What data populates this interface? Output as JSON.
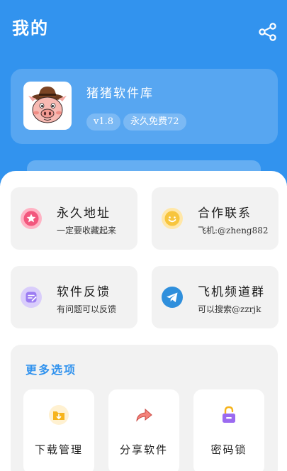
{
  "header": {
    "title": "我的",
    "share_icon": "share-icon",
    "background_color": "#3293ee"
  },
  "profile": {
    "app_name": "猪猪软件库",
    "version": "v1.8",
    "free_badge": "永久免费72",
    "avatar_icon": "pig-cowboy-avatar"
  },
  "tiles": [
    {
      "title": "永久地址",
      "subtitle": "一定要收藏起来",
      "icon": "star-icon"
    },
    {
      "title": "合作联系",
      "subtitle": "飞机:@zheng882",
      "icon": "smile-chat-icon"
    },
    {
      "title": "软件反馈",
      "subtitle": "有问题可以反馈",
      "icon": "feedback-icon"
    },
    {
      "title": "飞机频道群",
      "subtitle": "可以搜索@zzrjk",
      "icon": "telegram-icon"
    }
  ],
  "more": {
    "title": "更多选项",
    "options": [
      {
        "label": "下载管理",
        "icon": "download-folder-icon"
      },
      {
        "label": "分享软件",
        "icon": "share-arrow-icon"
      },
      {
        "label": "密码锁",
        "icon": "lock-icon"
      }
    ]
  },
  "colors": {
    "accent": "#3293ee",
    "tile_bg": "#f2f2f2"
  }
}
